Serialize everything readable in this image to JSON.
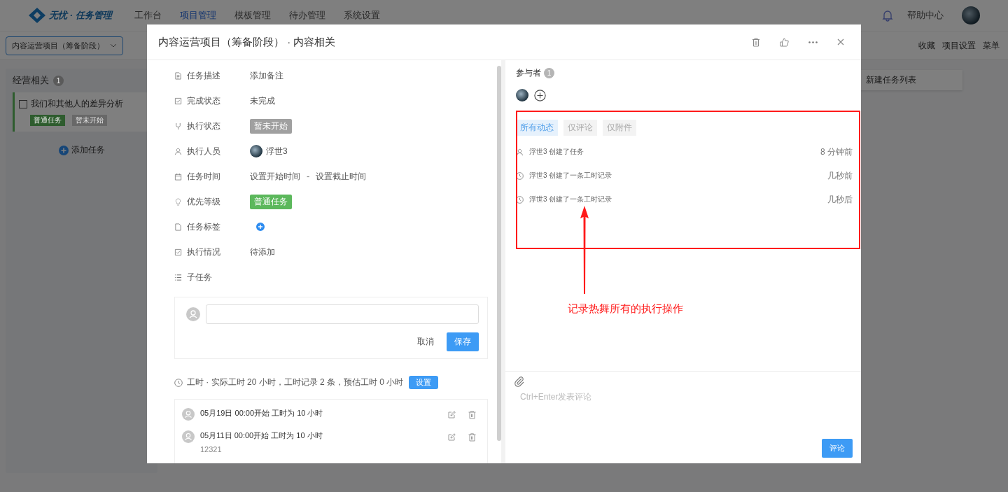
{
  "nav": {
    "logo": "无忧 · 任务管理",
    "items": [
      {
        "label": "工作台",
        "selected": false
      },
      {
        "label": "项目管理",
        "selected": true
      },
      {
        "label": "模板管理",
        "selected": false
      },
      {
        "label": "待办管理",
        "selected": false
      },
      {
        "label": "系统设置",
        "selected": false
      }
    ],
    "help": "帮助中心"
  },
  "toolbar": {
    "project": "内容运营项目（筹备阶段）",
    "actions": [
      "收藏",
      "项目设置",
      "菜单"
    ]
  },
  "board": {
    "lists": [
      {
        "title": "经营相关",
        "count": "1",
        "cards": [
          {
            "title": "我们和其他人的差异分析",
            "checked": false,
            "tags": [
              {
                "label": "普通任务",
                "color": "#2e5c2e"
              },
              {
                "label": "暂未开始",
                "color": "#686868"
              }
            ]
          }
        ],
        "add": "添加任务"
      }
    ],
    "new_list": "新建任务列表"
  },
  "modal": {
    "title": "内容运营项目（筹备阶段） · 内容相关",
    "fields": [
      {
        "label": "任务描述",
        "kind": "text",
        "value": "添加备注"
      },
      {
        "label": "完成状态",
        "kind": "text",
        "value": "未完成"
      },
      {
        "label": "执行状态",
        "kind": "tag",
        "value": "暂未开始",
        "color": "#a0a0a0"
      },
      {
        "label": "执行人员",
        "kind": "user",
        "value": "浮世3"
      },
      {
        "label": "任务时间",
        "kind": "range",
        "value": "设置开始时间",
        "separator": "-",
        "value_2": "设置截止时间"
      },
      {
        "label": "优先等级",
        "kind": "tag",
        "value": "普通任务",
        "color": "#5cb85c"
      },
      {
        "label": "任务标签",
        "kind": "add"
      },
      {
        "label": "执行情况",
        "kind": "text",
        "value": "待添加"
      },
      {
        "label": "子任务",
        "kind": "heading"
      }
    ],
    "subtask": {
      "cancel": "取消",
      "save": "保存"
    },
    "worktime": {
      "summary": "工时 · 实际工时 20 小时，工时记录 2 条，预估工时 0 小时",
      "button": "设置",
      "records": [
        {
          "text": "05月19日 00:00开始 工时为 10 小时"
        },
        {
          "text": "05月11日 00:00开始 工时为 10 小时",
          "note": "12321"
        }
      ]
    },
    "participants": {
      "label": "参与者",
      "count": "1"
    },
    "tabs": [
      {
        "label": "所有动态",
        "selected": true
      },
      {
        "label": "仅评论",
        "selected": false
      },
      {
        "label": "仅附件",
        "selected": false
      }
    ],
    "activities": [
      {
        "kind": "user",
        "text": "浮世3 创建了任务",
        "time": "8 分钟前"
      },
      {
        "kind": "clock",
        "text": "浮世3 创建了一条工时记录",
        "time": "几秒前"
      },
      {
        "kind": "clock",
        "text": "浮世3 创建了一条工时记录",
        "time": "几秒后"
      }
    ],
    "comment": {
      "placeholder": "Ctrl+Enter发表评论",
      "button": "评论"
    }
  },
  "annotation": {
    "text": "记录热舞所有的执行操作"
  }
}
